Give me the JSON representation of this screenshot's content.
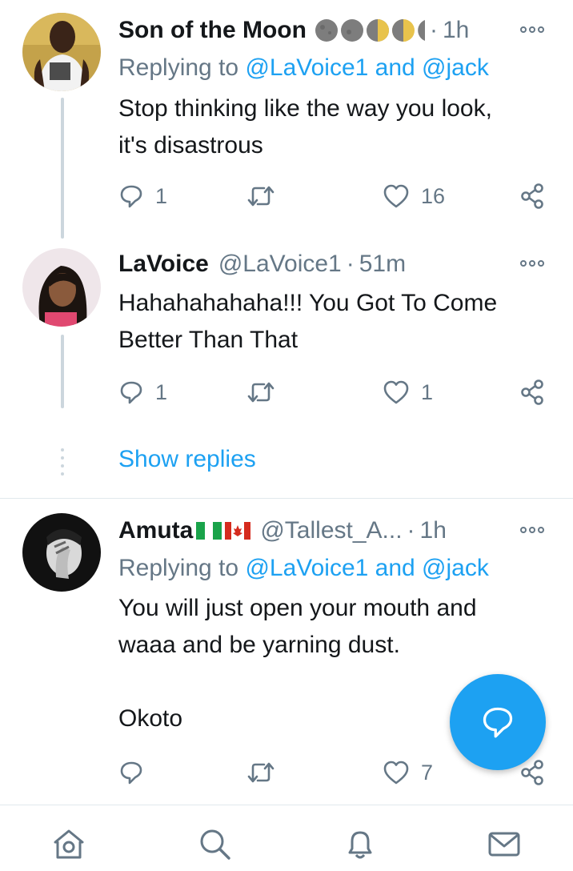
{
  "colors": {
    "accent": "#1da1f2",
    "muted": "#657786",
    "divider": "#e1e8ed"
  },
  "tweets": [
    {
      "name": "Son of the Moon",
      "name_emoji": "moon-phase-emojis",
      "handle": "",
      "time": "1h",
      "replying_prefix": "Replying to ",
      "replying_mentions": "@LaVoice1 and @jack",
      "text": "Stop thinking like the way you look,\nit's disastrous",
      "reply_count": "1",
      "retweet_count": "",
      "like_count": "16"
    },
    {
      "name": "LaVoice",
      "handle": "@LaVoice1",
      "time": "51m",
      "text": "Hahahahahaha!!! You Got To Come\nBetter Than That",
      "reply_count": "1",
      "retweet_count": "",
      "like_count": "1"
    },
    {
      "name": "Amuta",
      "name_emoji": "nigeria-flag canada-flag",
      "handle": "@Tallest_A...",
      "time": "1h",
      "replying_prefix": "Replying to ",
      "replying_mentions": "@LaVoice1 and @jack",
      "text": "You will just open your mouth and\nwaaa and be yarning dust.\n\nOkoto",
      "reply_count": "",
      "retweet_count": "",
      "like_count": "7"
    }
  ],
  "show_replies": "Show replies",
  "separator": "·",
  "nav": [
    "home-icon",
    "search-icon",
    "notifications-icon",
    "messages-icon"
  ]
}
